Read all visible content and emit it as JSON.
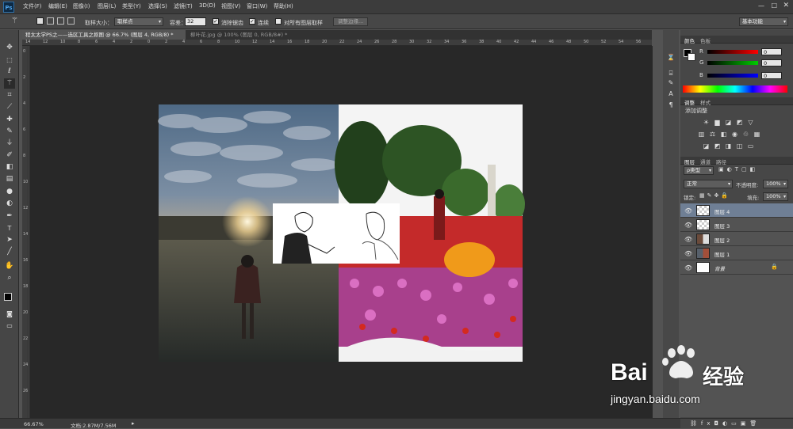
{
  "app": {
    "logo": "Ps"
  },
  "menu": [
    "文件(F)",
    "编辑(E)",
    "图像(I)",
    "图层(L)",
    "类型(Y)",
    "选择(S)",
    "滤镜(T)",
    "3D(D)",
    "视图(V)",
    "窗口(W)",
    "帮助(H)"
  ],
  "options": {
    "sample_size_label": "取样大小：",
    "sample_size_value": "取样点",
    "tolerance_label": "容差：",
    "tolerance_value": "32",
    "antialias_label": "消除锯齿",
    "contiguous_label": "连续",
    "sample_all_label": "对所有图层取样",
    "refine_edge_label": "调整边缘...",
    "workspace": "基本功能"
  },
  "tabs": [
    {
      "label": "程太太学PS之——选区工具之抠图 @ 66.7% (图层 4, RGB/8) *",
      "active": true
    },
    {
      "label": "柳叶花.jpg @ 100% (图层 0, RGB/8#) *",
      "active": false
    }
  ],
  "ruler_top": [
    "14",
    "12",
    "10",
    "8",
    "6",
    "4",
    "2",
    "0",
    "2",
    "4",
    "6",
    "8",
    "10",
    "12",
    "14",
    "16",
    "18",
    "20",
    "22",
    "24",
    "26",
    "28",
    "30",
    "32",
    "34",
    "36",
    "38",
    "40",
    "42",
    "44",
    "46",
    "48",
    "50",
    "52",
    "54",
    "56"
  ],
  "ruler_left": [
    "0",
    "2",
    "4",
    "6",
    "8",
    "10",
    "12",
    "14",
    "16",
    "18",
    "20",
    "22",
    "24",
    "26"
  ],
  "status": {
    "zoom": "66.67%",
    "doc": "文档:2.87M/7.56M"
  },
  "color_panel": {
    "tabs": [
      "颜色",
      "色板"
    ],
    "channels": [
      {
        "label": "R",
        "value": "0"
      },
      {
        "label": "G",
        "value": "0"
      },
      {
        "label": "B",
        "value": "0"
      }
    ]
  },
  "adjust_panel": {
    "tabs": [
      "调整",
      "样式"
    ],
    "title": "添加调整"
  },
  "layers_panel": {
    "tabs": [
      "图层",
      "通道",
      "路径"
    ],
    "kind_label": "ρ类型",
    "blend_mode": "正常",
    "opacity_label": "不透明度:",
    "opacity_value": "100%",
    "lock_label": "锁定:",
    "fill_label": "填充:",
    "fill_value": "100%",
    "layers": [
      {
        "name": "图层 4",
        "selected": true
      },
      {
        "name": "图层 3",
        "selected": false
      },
      {
        "name": "图层 2",
        "selected": false
      },
      {
        "name": "图层 1",
        "selected": false
      },
      {
        "name": "背景",
        "selected": false
      }
    ]
  },
  "watermark": {
    "brand_left": "Bai",
    "brand_right": "经验",
    "url": "jingyan.baidu.com"
  }
}
